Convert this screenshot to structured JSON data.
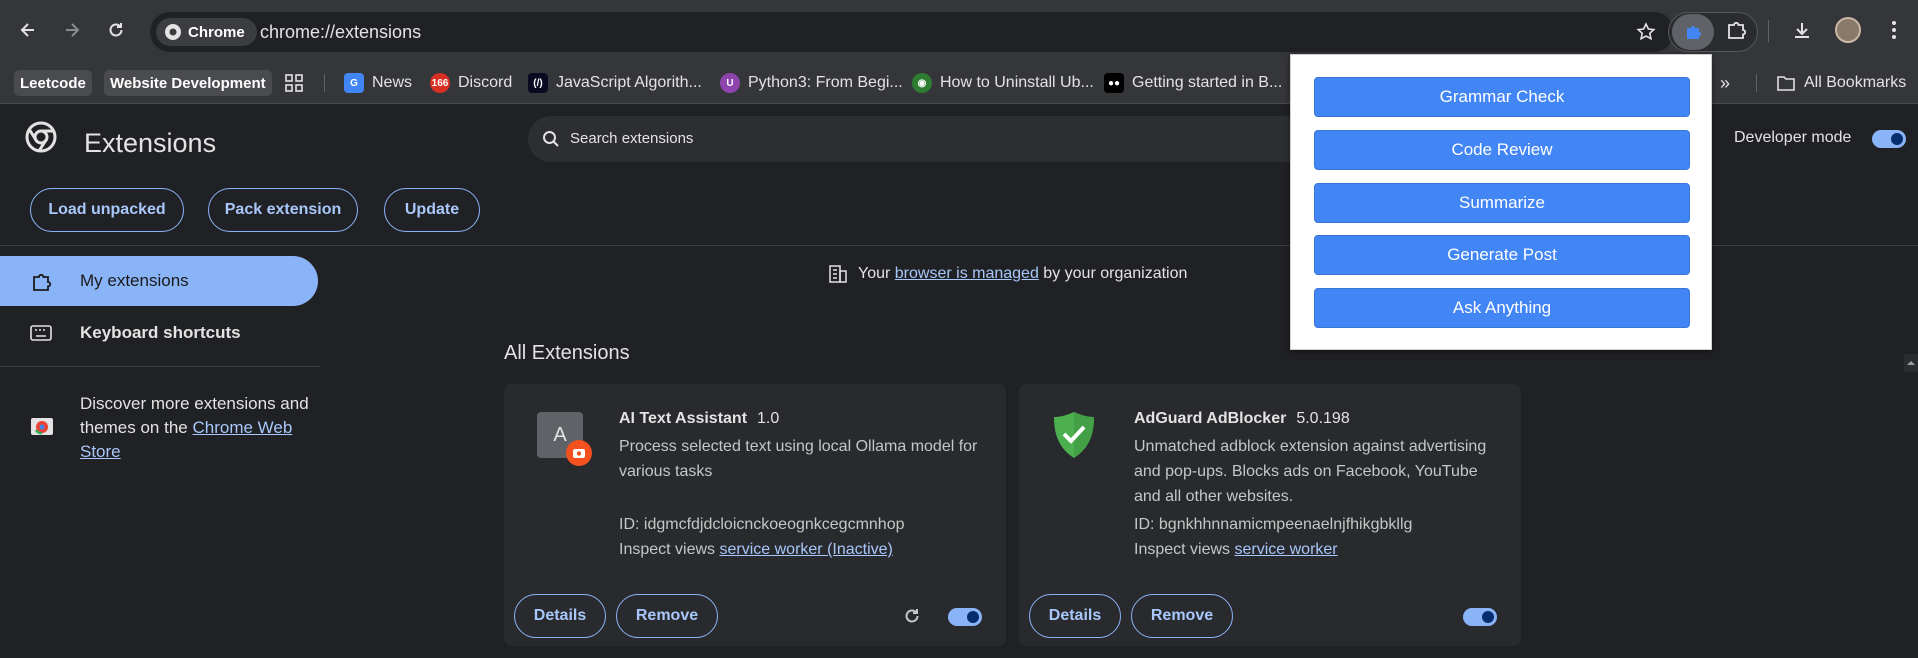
{
  "toolbar": {
    "chip_label": "Chrome",
    "url": "chrome://extensions"
  },
  "bookmarks": {
    "items": [
      {
        "label": "Leetcode"
      },
      {
        "label": "Website Development"
      },
      {
        "label": "News"
      },
      {
        "label": "Discord"
      },
      {
        "label": "JavaScript Algorith..."
      },
      {
        "label": "Python3: From Begi..."
      },
      {
        "label": "How to Uninstall Ub..."
      },
      {
        "label": "Getting started in B..."
      }
    ],
    "all_bookmarks": "All Bookmarks"
  },
  "header": {
    "title": "Extensions",
    "search_placeholder": "Search extensions",
    "developer_mode_label": "Developer mode",
    "developer_mode_on": true
  },
  "actions": {
    "load_unpacked": "Load unpacked",
    "pack_extension": "Pack extension",
    "update": "Update"
  },
  "sidebar": {
    "my_extensions": "My extensions",
    "keyboard_shortcuts": "Keyboard shortcuts",
    "discover_prefix": "Discover more extensions and themes on the ",
    "discover_link": "Chrome Web Store"
  },
  "managed": {
    "prefix": "Your ",
    "link": "browser is managed",
    "suffix": " by your organization"
  },
  "section_title": "All Extensions",
  "extensions": [
    {
      "name": "AI Text Assistant",
      "version": "1.0",
      "description": "Process selected text using local Ollama model for various tasks",
      "id_text": "ID: idgmcfdjdcloicnckoeognkcegcmnhop",
      "inspect_prefix": "Inspect views ",
      "inspect_link": "service worker (Inactive)",
      "icon_letter": "A",
      "enabled": true
    },
    {
      "name": "AdGuard AdBlocker",
      "version": "5.0.198",
      "description": "Unmatched adblock extension against advertising and pop-ups. Blocks ads on Facebook, YouTube and all other websites.",
      "id_text": "ID: bgnkhhnnamicmpeenaelnjfhikgbkllg",
      "inspect_prefix": "Inspect views ",
      "inspect_link": "service worker",
      "enabled": true
    }
  ],
  "card_buttons": {
    "details": "Details",
    "remove": "Remove"
  },
  "popup": {
    "buttons": [
      "Grammar Check",
      "Code Review",
      "Summarize",
      "Generate Post",
      "Ask Anything"
    ]
  },
  "colors": {
    "accent": "#8ab4f8",
    "popup_button": "#4285f4",
    "adguard_green": "#4caf50"
  }
}
